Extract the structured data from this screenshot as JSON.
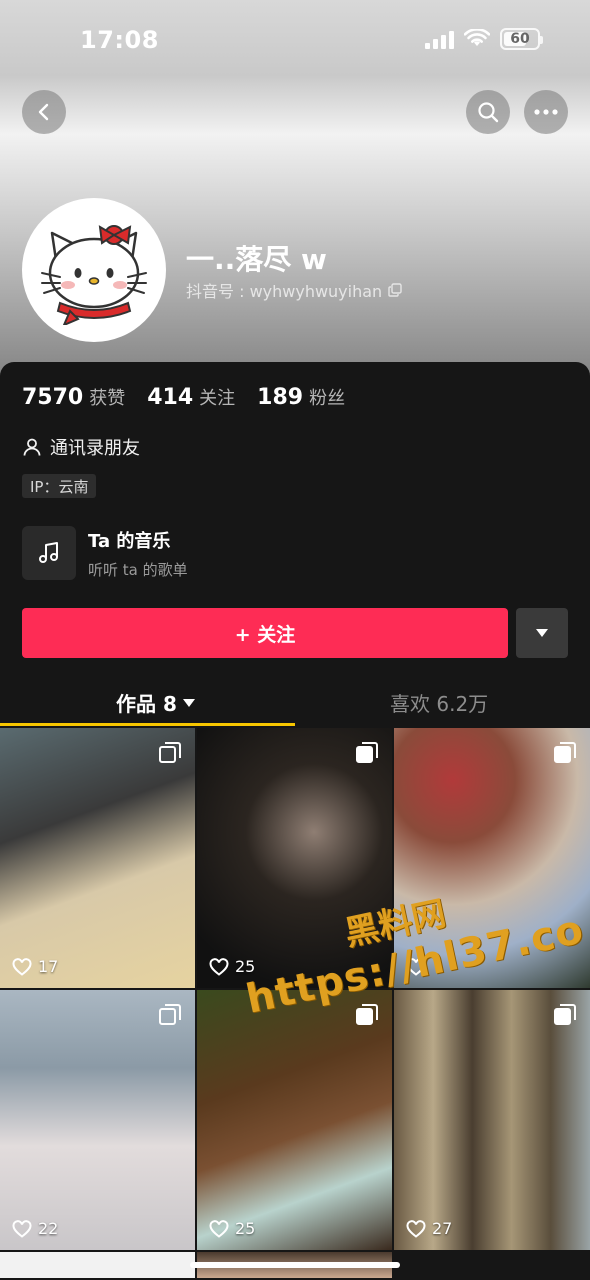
{
  "status_bar": {
    "time": "17:08",
    "battery": "60"
  },
  "profile": {
    "username": "一..落尽 w",
    "douyin_id": "抖音号 : wyhwyhwuyihan"
  },
  "stats": [
    {
      "num": "7570",
      "label": "获赞"
    },
    {
      "num": "414",
      "label": "关注"
    },
    {
      "num": "189",
      "label": "粉丝"
    }
  ],
  "contacts_label": "通讯录朋友",
  "ip_label": "IP：云南",
  "music": {
    "title": "Ta 的音乐",
    "subtitle": "听听 ta 的歌单"
  },
  "follow_label": "+ 关注",
  "tabs": {
    "works": "作品 8",
    "likes": "喜欢  6.2万"
  },
  "posts": [
    {
      "likes": "17"
    },
    {
      "likes": "25"
    },
    {
      "likes": ""
    },
    {
      "likes": "22"
    },
    {
      "likes": "25"
    },
    {
      "likes": "27"
    }
  ],
  "watermark": {
    "title": "黑料网",
    "url": "https://hl37.co"
  },
  "colors": {
    "accent": "#fe2c55",
    "tab_underline": "#f7c600",
    "background": "#161616"
  }
}
